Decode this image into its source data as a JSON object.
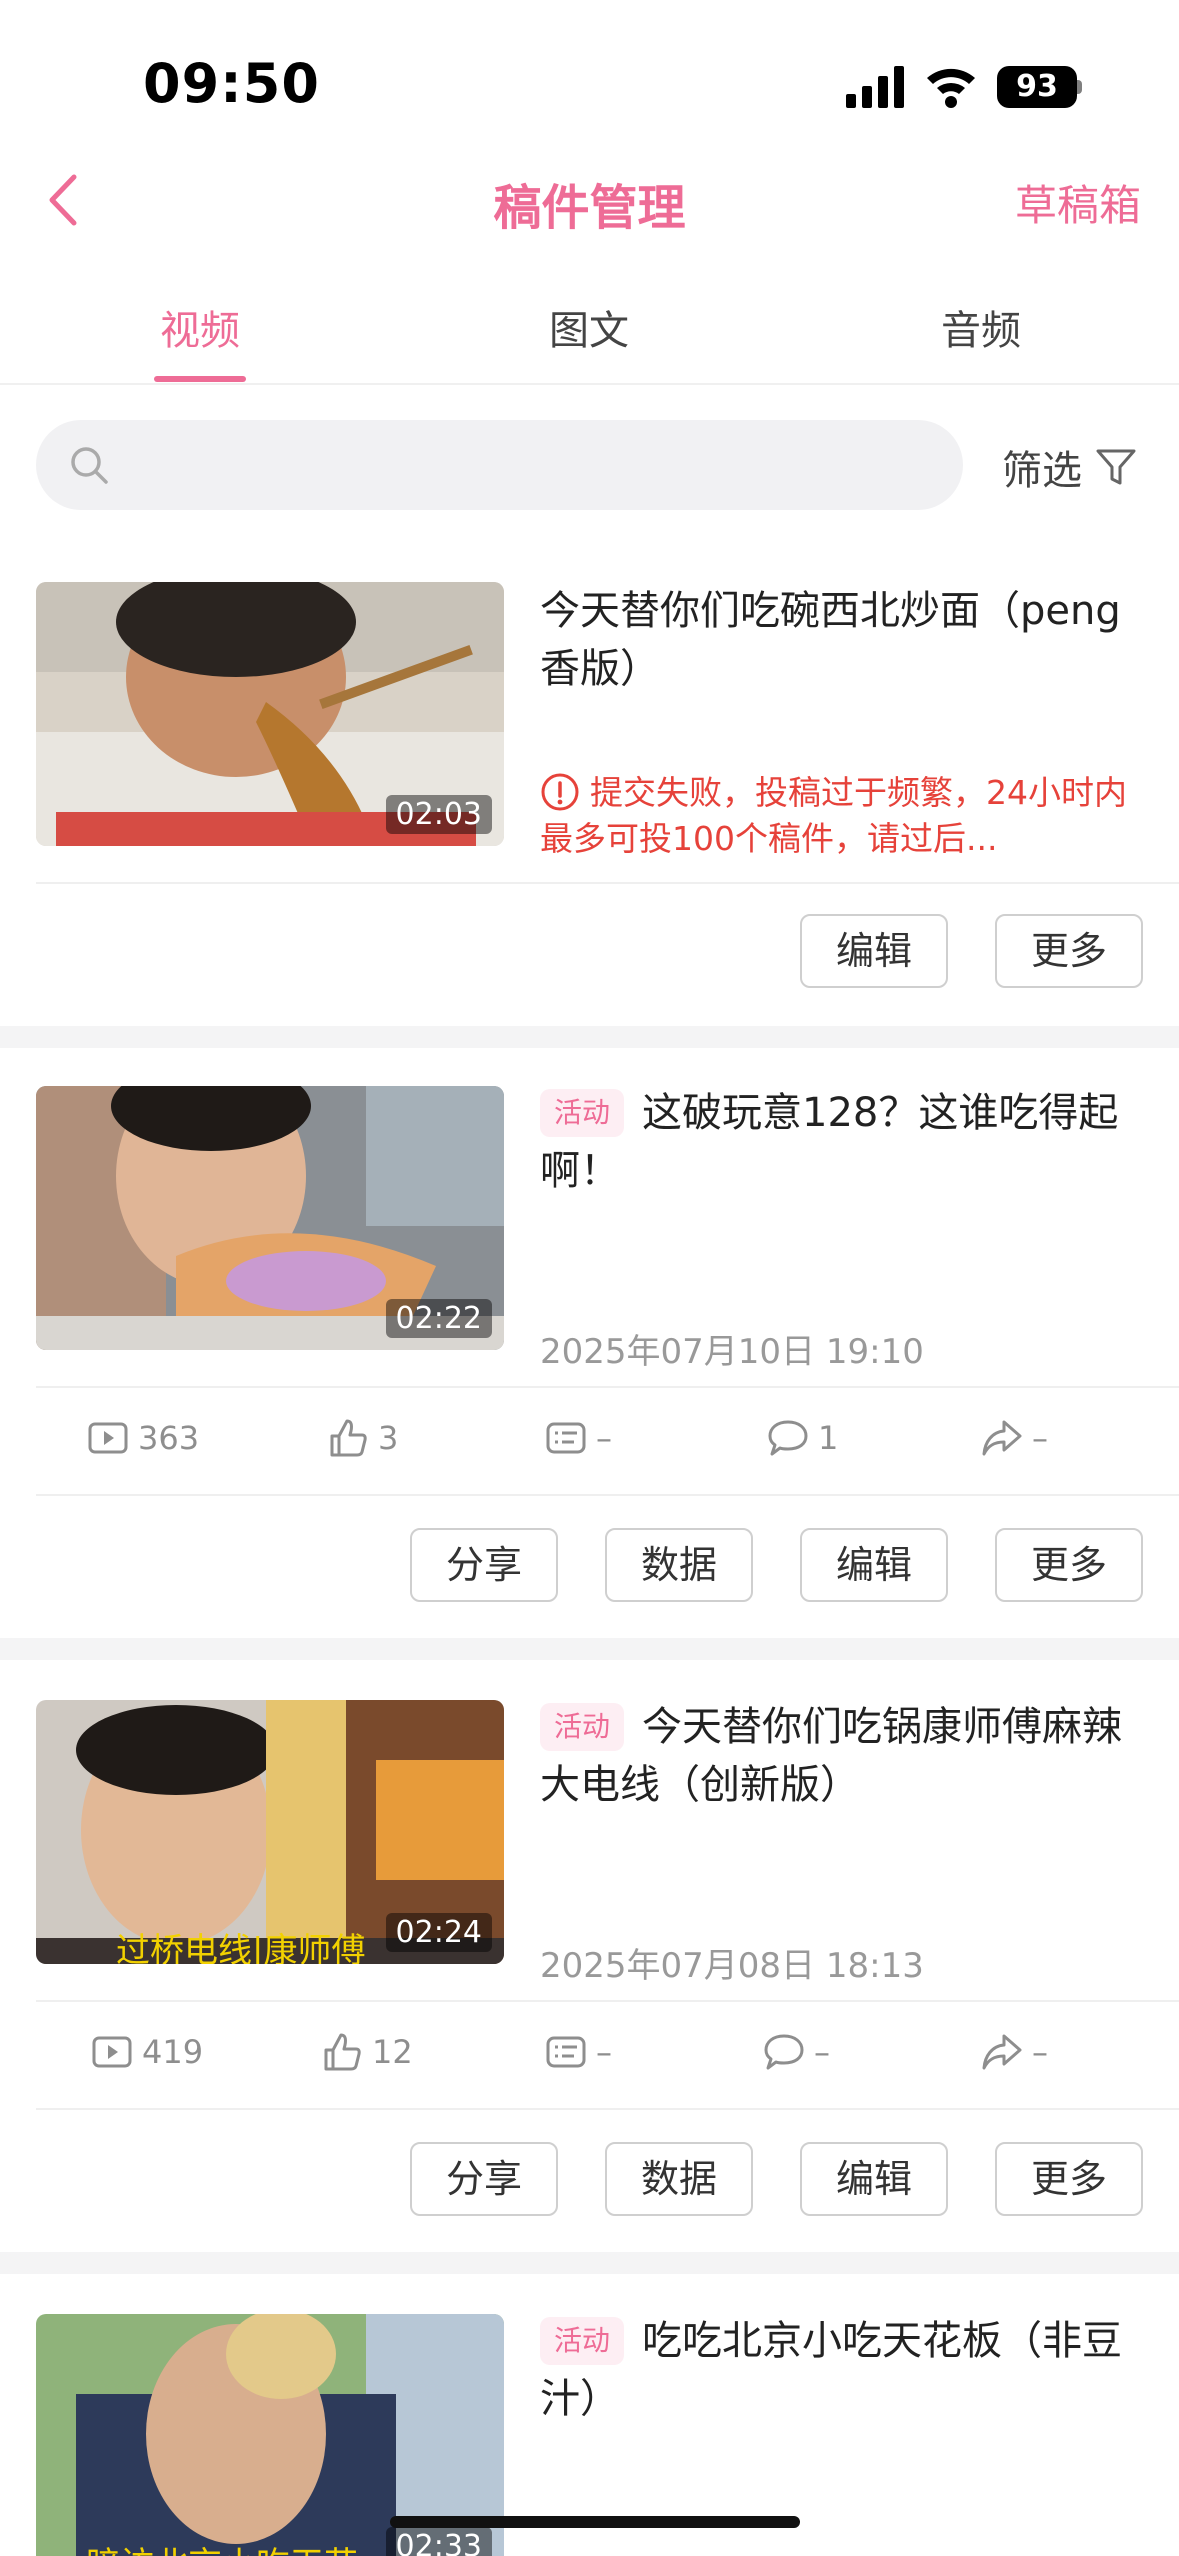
{
  "status": {
    "time": "09:50",
    "battery": "93"
  },
  "nav": {
    "title": "稿件管理",
    "drafts": "草稿箱"
  },
  "tabs": [
    "视频",
    "图文",
    "音频"
  ],
  "search": {
    "placeholder": "",
    "filter_label": "筛选"
  },
  "cards": [
    {
      "duration": "02:03",
      "title": "今天替你们吃碗西北炒面（peng香版）",
      "error": "提交失败，投稿过于频繁，24小时内最多可投100个稿件，请过后...",
      "actions": [
        "编辑",
        "更多"
      ]
    },
    {
      "duration": "02:22",
      "badge": "活动",
      "title": "这破玩意128？这谁吃得起啊！",
      "date": "2025年07月10日 19:10",
      "stats": {
        "plays": "363",
        "likes": "3",
        "danmaku": "–",
        "comments": "1",
        "shares": "–"
      },
      "actions": [
        "分享",
        "数据",
        "编辑",
        "更多"
      ]
    },
    {
      "duration": "02:24",
      "badge": "活动",
      "title": "今天替你们吃锅康师傅麻辣大电线（创新版）",
      "date": "2025年07月08日 18:13",
      "stats": {
        "plays": "419",
        "likes": "12",
        "danmaku": "–",
        "comments": "–",
        "shares": "–"
      },
      "actions": [
        "分享",
        "数据",
        "编辑",
        "更多"
      ]
    },
    {
      "duration": "02:33",
      "badge": "活动",
      "title": "吃吃北京小吃天花板（非豆汁）"
    }
  ],
  "colors": {
    "accent": "#ee6c96",
    "error": "#e6423a"
  }
}
